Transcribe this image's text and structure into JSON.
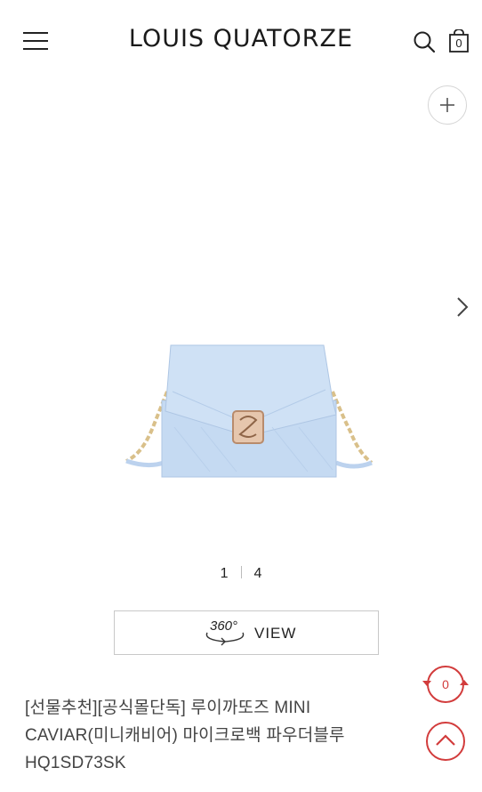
{
  "header": {
    "brand": "LOUIS QUATORZE",
    "menu_icon": "hamburger-menu-icon",
    "search_icon": "search-icon",
    "cart_icon": "shopping-bag-icon",
    "cart_count": "0"
  },
  "gallery": {
    "zoom_icon": "plus-icon",
    "next_icon": "chevron-right-icon",
    "current_page": "1",
    "total_pages": "4"
  },
  "view_button": {
    "badge": "360°",
    "label": "VIEW"
  },
  "product": {
    "title_line1": "[선물추천][공식몰단독] 루이까또즈 MINI",
    "title_line2": "CAVIAR(미니캐비어) 마이크로백 파우더블루",
    "title_line3": "HQ1SD73SK"
  },
  "floating": {
    "recent_count": "0",
    "top_icon": "chevron-up-icon"
  },
  "colors": {
    "accent": "#d23c3c",
    "bag": "#c5daf2"
  }
}
